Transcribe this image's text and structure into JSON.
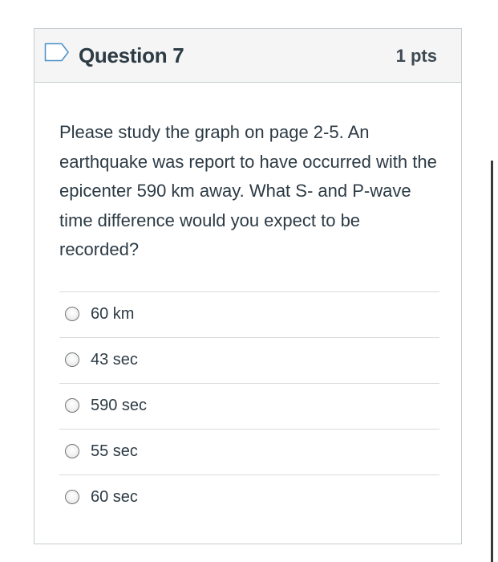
{
  "question": {
    "title": "Question 7",
    "points": "1 pts",
    "text": "Please study the graph on page 2-5. An earthquake was report to have occurred with the epicenter 590 km away. What S- and P-wave time difference would you expect to be recorded?",
    "flag_icon": "flag-outline-icon"
  },
  "answers": [
    {
      "label": "60 km",
      "selected": false
    },
    {
      "label": "43 sec",
      "selected": false
    },
    {
      "label": "590 sec",
      "selected": false
    },
    {
      "label": "55 sec",
      "selected": false
    },
    {
      "label": "60 sec",
      "selected": false
    }
  ],
  "colors": {
    "header_bg": "#f5f5f5",
    "border": "#c7cdd1",
    "text": "#2d3b45",
    "flag_stroke": "#4a90c8"
  }
}
